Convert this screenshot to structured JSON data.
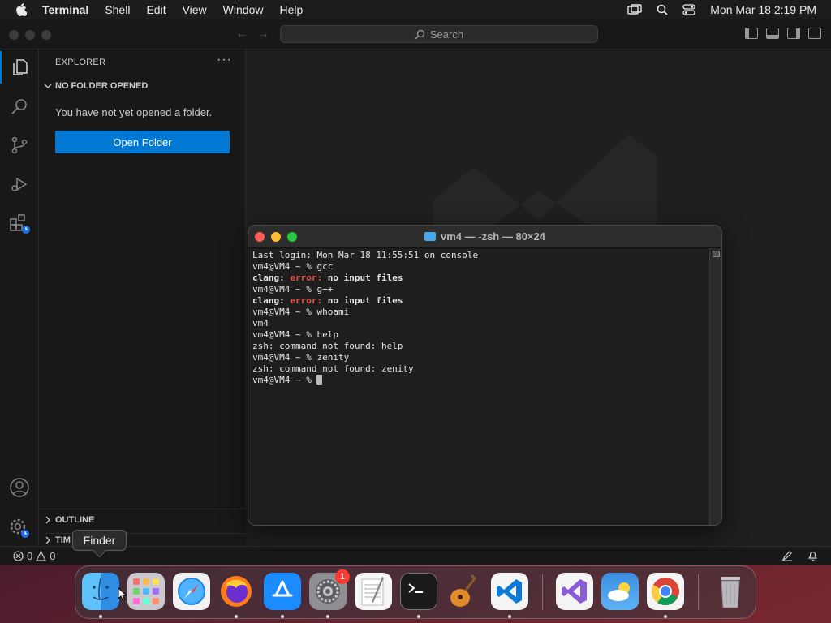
{
  "menubar": {
    "app_name": "Terminal",
    "items": [
      "Shell",
      "Edit",
      "View",
      "Window",
      "Help"
    ],
    "datetime": "Mon Mar 18  2:19 PM"
  },
  "vscode": {
    "search_placeholder": "Search",
    "sidebar": {
      "title": "EXPLORER",
      "more": "···",
      "section": "NO FOLDER OPENED",
      "message": "You have not yet opened a folder.",
      "open_folder_button": "Open Folder",
      "outline_section": "OUTLINE",
      "timeline_section": "TIM"
    },
    "status": {
      "errors": "0",
      "warnings": "0"
    },
    "colors": {
      "accent": "#0078d4",
      "background": "#1f1f1f"
    }
  },
  "terminal": {
    "title": "vm4 — -zsh — 80×24",
    "lines": [
      {
        "text": "Last login: Mon Mar 18 11:55:51 on console"
      },
      {
        "text": "vm4@VM4 ~ % gcc"
      },
      {
        "pre": "clang: ",
        "err": "error:",
        "post": " no input files"
      },
      {
        "text": "vm4@VM4 ~ % g++"
      },
      {
        "pre": "clang: ",
        "err": "error:",
        "post": " no input files"
      },
      {
        "text": "vm4@VM4 ~ % whoami"
      },
      {
        "text": "vm4"
      },
      {
        "text": "vm4@VM4 ~ % help"
      },
      {
        "text": "zsh: command not found: help"
      },
      {
        "text": "vm4@VM4 ~ % zenity"
      },
      {
        "text": "zsh: command not found: zenity"
      },
      {
        "text": "vm4@VM4 ~ % "
      }
    ]
  },
  "tooltip": "Finder",
  "dock": {
    "apps": [
      "finder-icon",
      "launchpad-icon",
      "safari-icon",
      "firefox-icon",
      "app-store-icon",
      "system-settings-icon",
      "textedit-icon",
      "terminal-icon",
      "garageband-icon",
      "vscode-icon",
      "visual-studio-icon",
      "weather-icon",
      "chrome-icon",
      "trash-icon"
    ],
    "settings_badge": "1"
  }
}
